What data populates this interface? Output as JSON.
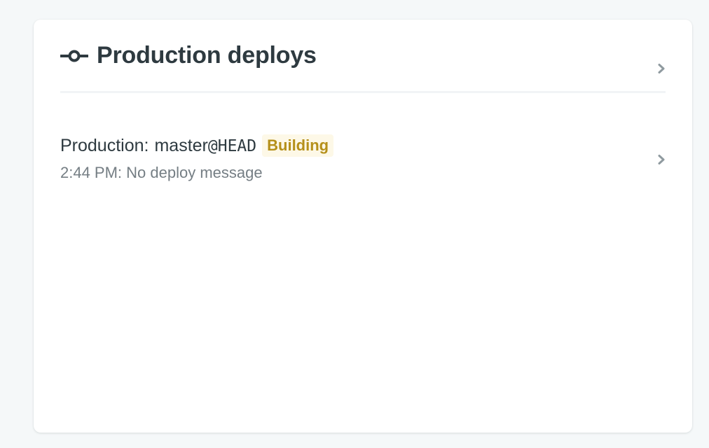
{
  "card": {
    "title": "Production deploys"
  },
  "deploy": {
    "context_label": "Production:",
    "branch": "master",
    "ref": "@HEAD",
    "status": "Building",
    "time": "2:44 PM:",
    "message": "No deploy message"
  },
  "colors": {
    "page_background": "#f5f8f9",
    "title_text": "#2e3a40",
    "muted_text": "#757e84",
    "badge_text": "#b5901a",
    "badge_background": "#fdf8e7",
    "chevron": "#8f9a9f"
  },
  "icons": {
    "header": "commit-icon",
    "header_link": "chevron-right-icon",
    "row_link": "chevron-right-icon"
  }
}
